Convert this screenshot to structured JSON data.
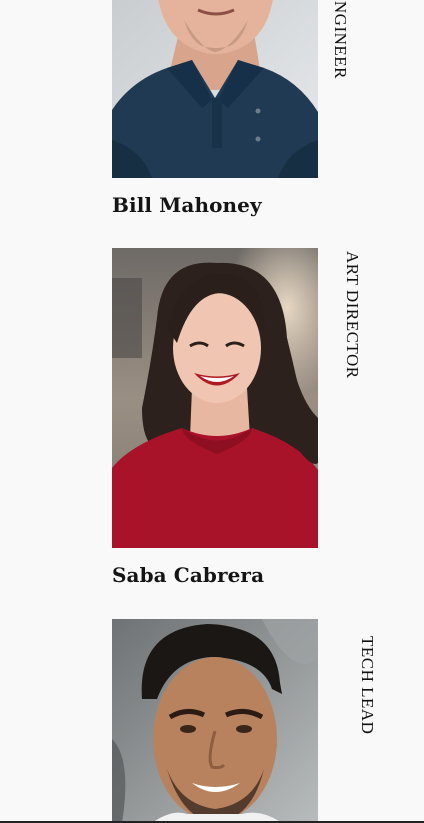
{
  "team": {
    "members": [
      {
        "name": "Bill Mahoney",
        "role": "ENGINEER",
        "photo_alt": "Bill Mahoney"
      },
      {
        "name": "Saba Cabrera",
        "role": "ART DIRECTOR",
        "photo_alt": "Saba Cabrera"
      },
      {
        "name": "",
        "role": "TECH LEAD",
        "photo_alt": "Tech lead"
      }
    ]
  }
}
